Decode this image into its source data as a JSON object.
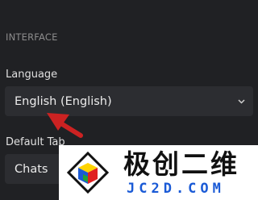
{
  "interface": {
    "section_header": "INTERFACE",
    "language_label": "Language",
    "language_value": "English (English)",
    "default_tab_label": "Default Tab",
    "default_tab_value": "Chats"
  },
  "watermark": {
    "title": "极创二维",
    "domain": "JC2D.COM"
  },
  "colors": {
    "background": "#202124",
    "field_background": "#2c2d31",
    "arrow": "#cc2222",
    "watermark_domain": "#1a5ad6"
  },
  "icons": [
    "chevron-down-icon",
    "red-arrow-annotation",
    "cube-logo-icon"
  ]
}
